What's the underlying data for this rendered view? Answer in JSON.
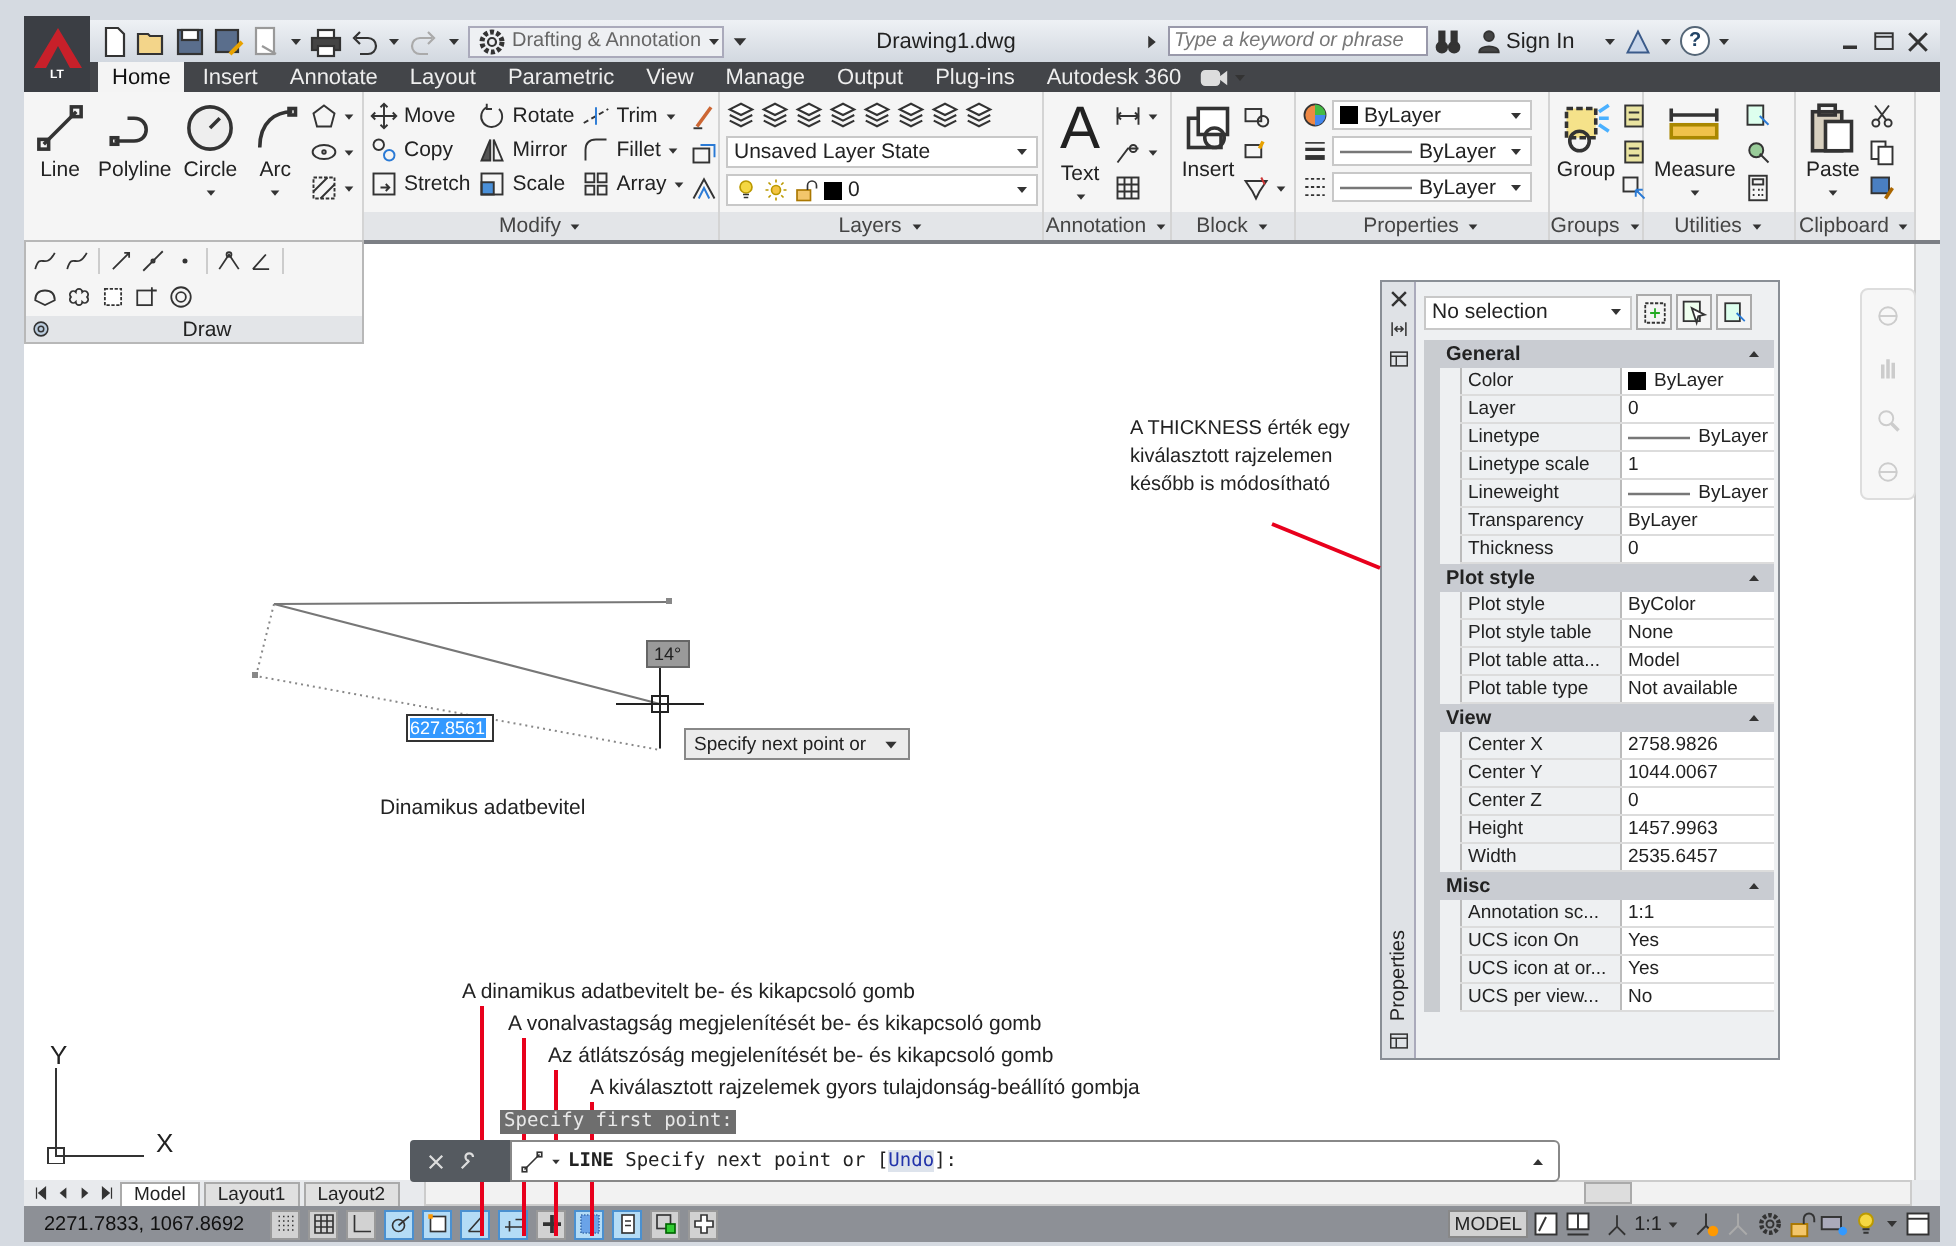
{
  "app": {
    "logo_text": "LT"
  },
  "title_bar": {
    "workspace": "Drafting & Annotation",
    "title": "Drawing1.dwg",
    "search": {
      "placeholder": "Type a keyword or phrase"
    },
    "sign_in": "Sign In",
    "help": "?"
  },
  "tabs": [
    {
      "label": "Home",
      "selected": true
    },
    {
      "label": "Insert",
      "selected": false
    },
    {
      "label": "Annotate",
      "selected": false
    },
    {
      "label": "Layout",
      "selected": false
    },
    {
      "label": "Parametric",
      "selected": false
    },
    {
      "label": "View",
      "selected": false
    },
    {
      "label": "Manage",
      "selected": false
    },
    {
      "label": "Output",
      "selected": false
    },
    {
      "label": "Plug-ins",
      "selected": false
    },
    {
      "label": "Autodesk 360",
      "selected": false
    }
  ],
  "ribbon": {
    "panels": [
      {
        "kind": "draw",
        "label": "Draw",
        "tools": [
          {
            "label": "Line",
            "dropdown": false
          },
          {
            "label": "Polyline",
            "dropdown": false
          },
          {
            "label": "Circle",
            "dropdown": true
          },
          {
            "label": "Arc",
            "dropdown": true
          }
        ]
      },
      {
        "kind": "modify",
        "label": "Modify",
        "tools": [
          {
            "label": "Move",
            "dropdown": false
          },
          {
            "label": "Rotate",
            "dropdown": false
          },
          {
            "label": "Trim",
            "dropdown": true
          },
          {
            "label": "Copy",
            "dropdown": false
          },
          {
            "label": "Mirror",
            "dropdown": false
          },
          {
            "label": "Fillet",
            "dropdown": true
          },
          {
            "label": "Stretch",
            "dropdown": false
          },
          {
            "label": "Scale",
            "dropdown": false
          },
          {
            "label": "Array",
            "dropdown": true
          }
        ]
      },
      {
        "kind": "layers",
        "label": "Layers",
        "layer_state": "Unsaved Layer State",
        "layer": "0"
      },
      {
        "kind": "annotation",
        "label": "Annotation",
        "glyph": "A",
        "tool": {
          "label": "Text",
          "dropdown": true
        }
      },
      {
        "kind": "block",
        "label": "Block",
        "tool": {
          "label": "Insert",
          "dropdown": false
        }
      },
      {
        "kind": "properties",
        "label": "Properties",
        "rows": [
          "ByLayer",
          "ByLayer",
          "ByLayer"
        ]
      },
      {
        "kind": "groups",
        "label": "Groups",
        "tool": {
          "label": "Group",
          "dropdown": false
        }
      },
      {
        "kind": "utilities",
        "label": "Utilities",
        "tool": {
          "label": "Measure",
          "dropdown": true
        }
      },
      {
        "kind": "clipboard",
        "label": "Clipboard",
        "tool": {
          "label": "Paste",
          "dropdown": true
        }
      }
    ]
  },
  "canvas": {
    "angle": "14°",
    "dimension_input": "627.8561",
    "tooltip": "Specify next point or",
    "dynamic_label": "Dinamikus adatbevitel",
    "note": "A THICKNESS érték egy kiválasztott rajzelemen később is módosítható",
    "callouts": [
      "A dinamikus adatbevitelt be- és kikapcsoló gomb",
      "A vonalvastagság megjelenítését be- és kikapcsoló gomb",
      "Az átlátszóság megjelenítését be- és kikapcsoló gomb",
      "A kiválasztott rajzelemek gyors tulajdonság-beállító gombja"
    ],
    "ucs": {
      "x": "X",
      "y": "Y"
    }
  },
  "properties_palette": {
    "title": "Properties",
    "selection": "No selection",
    "sections": [
      {
        "title": "General",
        "expanded": true,
        "rows": [
          {
            "label": "Color",
            "value": "ByLayer",
            "kind": "swatch"
          },
          {
            "label": "Layer",
            "value": "0",
            "kind": "text"
          },
          {
            "label": "Linetype",
            "value": "ByLayer",
            "kind": "line"
          },
          {
            "label": "Linetype scale",
            "value": "1",
            "kind": "text"
          },
          {
            "label": "Lineweight",
            "value": "ByLayer",
            "kind": "line"
          },
          {
            "label": "Transparency",
            "value": "ByLayer",
            "kind": "text"
          },
          {
            "label": "Thickness",
            "value": "0",
            "kind": "text"
          }
        ]
      },
      {
        "title": "Plot style",
        "expanded": true,
        "rows": [
          {
            "label": "Plot style",
            "value": "ByColor",
            "kind": "text"
          },
          {
            "label": "Plot style table",
            "value": "None",
            "kind": "text"
          },
          {
            "label": "Plot table atta...",
            "value": "Model",
            "kind": "text"
          },
          {
            "label": "Plot table type",
            "value": "Not available",
            "kind": "text"
          }
        ]
      },
      {
        "title": "View",
        "expanded": true,
        "rows": [
          {
            "label": "Center X",
            "value": "2758.9826",
            "kind": "text"
          },
          {
            "label": "Center Y",
            "value": "1044.0067",
            "kind": "text"
          },
          {
            "label": "Center Z",
            "value": "0",
            "kind": "text"
          },
          {
            "label": "Height",
            "value": "1457.9963",
            "kind": "text"
          },
          {
            "label": "Width",
            "value": "2535.6457",
            "kind": "text"
          }
        ]
      },
      {
        "title": "Misc",
        "expanded": true,
        "rows": [
          {
            "label": "Annotation sc...",
            "value": "1:1",
            "kind": "text"
          },
          {
            "label": "UCS icon On",
            "value": "Yes",
            "kind": "text"
          },
          {
            "label": "UCS icon at or...",
            "value": "Yes",
            "kind": "text"
          },
          {
            "label": "UCS per view...",
            "value": "No",
            "kind": "text"
          }
        ]
      }
    ]
  },
  "command_line": {
    "history": "Specify first point:",
    "command": "LINE",
    "prompt": "Specify next point or [",
    "option": "Undo",
    "prompt_end": "]:"
  },
  "layout_tabs": [
    {
      "label": "Model",
      "selected": true
    },
    {
      "label": "Layout1",
      "selected": false
    },
    {
      "label": "Layout2",
      "selected": false
    }
  ],
  "status_bar": {
    "coordinates": "2271.7833, 1067.8692",
    "toggles": [
      {
        "on": false
      },
      {
        "on": false
      },
      {
        "on": false
      },
      {
        "on": true
      },
      {
        "on": true
      },
      {
        "on": true
      },
      {
        "on": true
      },
      {
        "on": false
      },
      {
        "on": true
      },
      {
        "on": true
      },
      {
        "on": false
      },
      {
        "on": false
      }
    ],
    "space": "MODEL",
    "annotation_scale": "1:1"
  }
}
